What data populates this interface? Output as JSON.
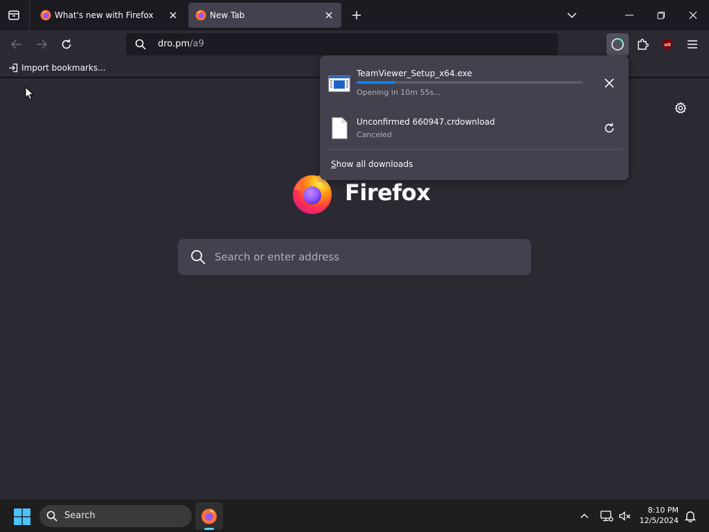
{
  "tabs": [
    {
      "title": "What's new with Firefox",
      "active": false
    },
    {
      "title": "New Tab",
      "active": true
    }
  ],
  "urlbar": {
    "host": "dro.pm",
    "path": "/a9"
  },
  "bookmarks": {
    "import_label": "Import bookmarks..."
  },
  "homepage": {
    "wordmark": "Firefox",
    "search_placeholder": "Search or enter address"
  },
  "downloads": {
    "items": [
      {
        "name": "TeamViewer_Setup_x64.exe",
        "status": "Opening in 10m 55s...",
        "progress": 0.17,
        "action": "cancel"
      },
      {
        "name": "Unconfirmed 660947.crdownload",
        "status": "Canceled",
        "action": "retry"
      }
    ],
    "show_all_label": "Show all downloads",
    "show_all_accesskey": "S"
  },
  "taskbar": {
    "search_label": "Search",
    "time": "8:10 PM",
    "date": "12/5/2024"
  },
  "colors": {
    "accent": "#0a84ff",
    "panel": "#42414d",
    "toolbar": "#2b2a33",
    "tabstrip": "#1c1b22",
    "taskbar_indicator": "#60cdff"
  }
}
